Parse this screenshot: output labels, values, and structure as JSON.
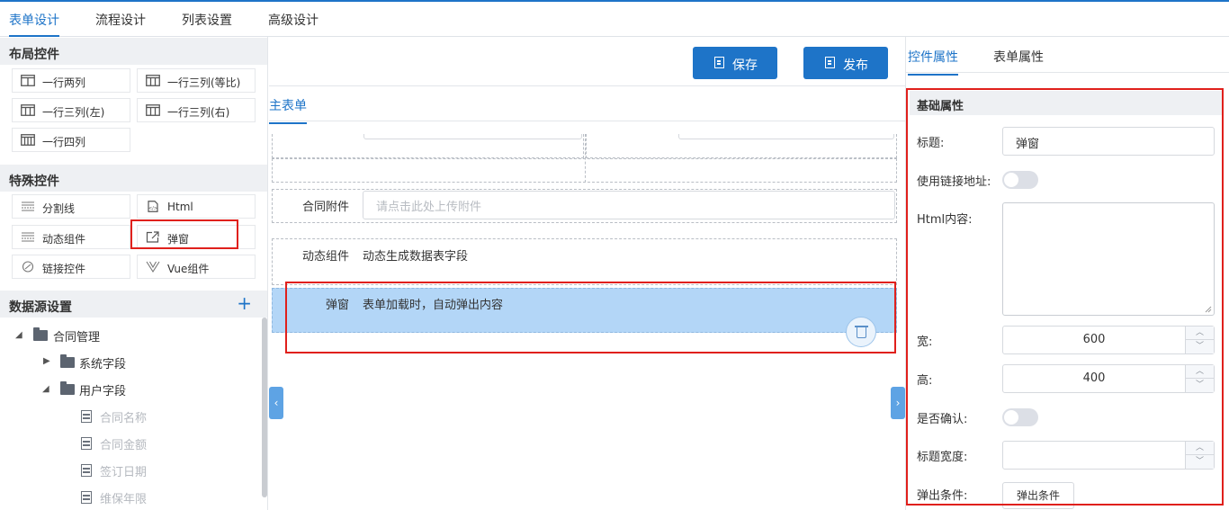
{
  "top_tabs": [
    "表单设计",
    "流程设计",
    "列表设置",
    "高级设计"
  ],
  "left": {
    "layout_title": "布局控件",
    "layout_controls": [
      "一行两列",
      "一行三列(等比)",
      "一行三列(左)",
      "一行三列(右)",
      "一行四列"
    ],
    "special_title": "特殊控件",
    "special_controls": [
      "分割线",
      "Html",
      "动态组件",
      "弹窗",
      "链接控件",
      "Vue组件"
    ],
    "datasource_title": "数据源设置",
    "datasource_add": "+",
    "tree": {
      "root": "合同管理",
      "system": "系统字段",
      "user": "用户字段",
      "fields": [
        "合同名称",
        "合同金额",
        "签订日期",
        "维保年限"
      ]
    }
  },
  "toolbar": {
    "save": "保存",
    "publish": "发布"
  },
  "form": {
    "tab": "主表单",
    "attachment_label": "合同附件",
    "attachment_placeholder": "请点击此处上传附件",
    "dynamic_label": "动态组件",
    "dynamic_value": "动态生成数据表字段",
    "popup_label": "弹窗",
    "popup_value": "表单加载时，自动弹出内容"
  },
  "props": {
    "tabs": [
      "控件属性",
      "表单属性"
    ],
    "section": "基础属性",
    "title_label": "标题:",
    "title_value": "弹窗",
    "use_link_label": "使用链接地址:",
    "html_label": "Html内容:",
    "width_label": "宽:",
    "width_value": "600",
    "height_label": "高:",
    "height_value": "400",
    "confirm_label": "是否确认:",
    "title_width_label": "标题宽度:",
    "title_width_value": "",
    "condition_label": "弹出条件:",
    "condition_button": "弹出条件"
  },
  "colors": {
    "accent": "#1e74c8",
    "highlight": "#b3d6f7",
    "annotation": "#e0201c"
  }
}
